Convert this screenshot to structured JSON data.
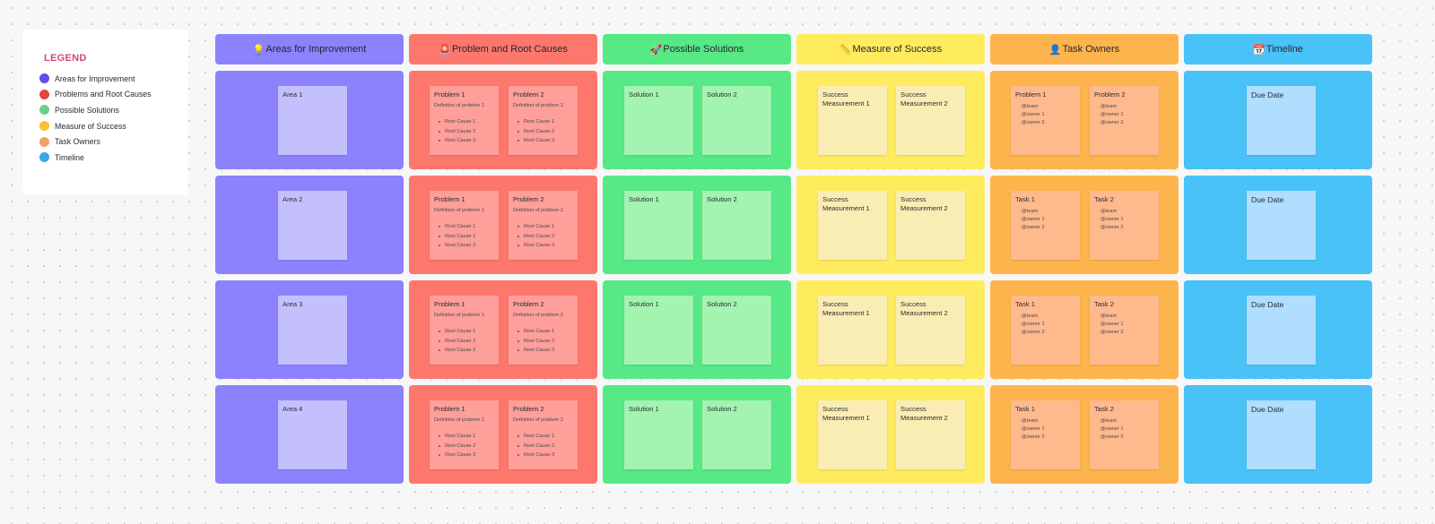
{
  "legend": {
    "title": "LEGEND",
    "items": [
      {
        "label": "Areas for Improvement",
        "color": "#5b4ff0"
      },
      {
        "label": "Problems and Root Causes",
        "color": "#e8433f"
      },
      {
        "label": "Possible Solutions",
        "color": "#6fcf8a"
      },
      {
        "label": "Measure of Success",
        "color": "#f8c233"
      },
      {
        "label": "Task Owners",
        "color": "#efa36a"
      },
      {
        "label": "Timeline",
        "color": "#3aa6e8"
      }
    ]
  },
  "columns": [
    {
      "title": "Areas for Improvement",
      "icon": "💡",
      "icon_name": "lightbulb-icon",
      "color": "#8c82fe",
      "sticky_color": "#c4c0fd",
      "rows": [
        {
          "stickies": [
            {
              "title": "Area 1"
            }
          ]
        },
        {
          "stickies": [
            {
              "title": "Area 2"
            }
          ]
        },
        {
          "stickies": [
            {
              "title": "Area 3"
            }
          ]
        },
        {
          "stickies": [
            {
              "title": "Area 4"
            }
          ]
        }
      ]
    },
    {
      "title": "Problem and Root Causes",
      "icon": "🚨",
      "icon_name": "siren-icon",
      "color": "#fe776d",
      "sticky_color": "#fe9f9a",
      "rows": [
        {
          "stickies": [
            {
              "title": "Problem 1",
              "subtitle": "Definition of problem 1",
              "bullets": [
                "Root Cause 1",
                "Root Cause 2",
                "Root Cause 3"
              ]
            },
            {
              "title": "Problem 2",
              "subtitle": "Definition of problem 2",
              "bullets": [
                "Root Cause 1",
                "Root Cause 2",
                "Root Cause 3"
              ]
            }
          ]
        },
        {
          "stickies": [
            {
              "title": "Problem 1",
              "subtitle": "Definition of problem 1",
              "bullets": [
                "Root Cause 1",
                "Root Cause 2",
                "Root Cause 3"
              ]
            },
            {
              "title": "Problem 2",
              "subtitle": "Definition of problem 2",
              "bullets": [
                "Root Cause 1",
                "Root Cause 2",
                "Root Cause 3"
              ]
            }
          ]
        },
        {
          "stickies": [
            {
              "title": "Problem 1",
              "subtitle": "Definition of problem 1",
              "bullets": [
                "Root Cause 1",
                "Root Cause 2",
                "Root Cause 3"
              ]
            },
            {
              "title": "Problem 2",
              "subtitle": "Definition of problem 2",
              "bullets": [
                "Root Cause 1",
                "Root Cause 2",
                "Root Cause 3"
              ]
            }
          ]
        },
        {
          "stickies": [
            {
              "title": "Problem 1",
              "subtitle": "Definition of problem 1",
              "bullets": [
                "Root Cause 1",
                "Root Cause 2",
                "Root Cause 3"
              ]
            },
            {
              "title": "Problem 2",
              "subtitle": "Definition of problem 2",
              "bullets": [
                "Root Cause 1",
                "Root Cause 2",
                "Root Cause 3"
              ]
            }
          ]
        }
      ]
    },
    {
      "title": "Possible Solutions",
      "icon": "🚀",
      "icon_name": "rocket-icon",
      "color": "#56e986",
      "sticky_color": "#a3f3b1",
      "rows": [
        {
          "stickies": [
            {
              "title": "Solution 1"
            },
            {
              "title": "Solution 2"
            }
          ]
        },
        {
          "stickies": [
            {
              "title": "Solution 1"
            },
            {
              "title": "Solution 2"
            }
          ]
        },
        {
          "stickies": [
            {
              "title": "Solution 1"
            },
            {
              "title": "Solution 2"
            }
          ]
        },
        {
          "stickies": [
            {
              "title": "Solution 1"
            },
            {
              "title": "Solution 2"
            }
          ]
        }
      ]
    },
    {
      "title": "Measure of Success",
      "icon": "📏",
      "icon_name": "ruler-icon",
      "color": "#ffec5e",
      "sticky_color": "#faedb3",
      "rows": [
        {
          "stickies": [
            {
              "title": "Success Measurement 1"
            },
            {
              "title": "Success Measurement 2"
            }
          ]
        },
        {
          "stickies": [
            {
              "title": "Success Measurement 1"
            },
            {
              "title": "Success Measurement 2"
            }
          ]
        },
        {
          "stickies": [
            {
              "title": "Success Measurement 1"
            },
            {
              "title": "Success Measurement 2"
            }
          ]
        },
        {
          "stickies": [
            {
              "title": "Success Measurement 1"
            },
            {
              "title": "Success Measurement 2"
            }
          ]
        }
      ]
    },
    {
      "title": "Task Owners",
      "icon": "👤",
      "icon_name": "user-icon",
      "color": "#feb44c",
      "sticky_color": "#feb98d",
      "rows": [
        {
          "stickies": [
            {
              "title": "Problem 1",
              "owners": [
                "@team",
                "@owner 1",
                "@owner 2"
              ]
            },
            {
              "title": "Problem 2",
              "owners": [
                "@team",
                "@owner 1",
                "@owner 2"
              ]
            }
          ]
        },
        {
          "stickies": [
            {
              "title": "Task 1",
              "owners": [
                "@team",
                "@owner 1",
                "@owner 2"
              ]
            },
            {
              "title": "Task 2",
              "owners": [
                "@team",
                "@owner 1",
                "@owner 2"
              ]
            }
          ]
        },
        {
          "stickies": [
            {
              "title": "Task 1",
              "owners": [
                "@team",
                "@owner 1",
                "@owner 2"
              ]
            },
            {
              "title": "Task 2",
              "owners": [
                "@team",
                "@owner 1",
                "@owner 2"
              ]
            }
          ]
        },
        {
          "stickies": [
            {
              "title": "Task 1",
              "owners": [
                "@team",
                "@owner 1",
                "@owner 2"
              ]
            },
            {
              "title": "Task 2",
              "owners": [
                "@team",
                "@owner 1",
                "@owner 2"
              ]
            }
          ]
        }
      ]
    },
    {
      "title": "Timeline",
      "icon": "📆",
      "icon_name": "calendar-icon",
      "color": "#49c2f7",
      "sticky_color": "#b0defe",
      "rows": [
        {
          "stickies": [
            {
              "title": "Due Date",
              "big": true
            }
          ]
        },
        {
          "stickies": [
            {
              "title": "Due Date",
              "big": true
            }
          ]
        },
        {
          "stickies": [
            {
              "title": "Due Date",
              "big": true
            }
          ]
        },
        {
          "stickies": [
            {
              "title": "Due Date",
              "big": true
            }
          ]
        }
      ]
    }
  ]
}
